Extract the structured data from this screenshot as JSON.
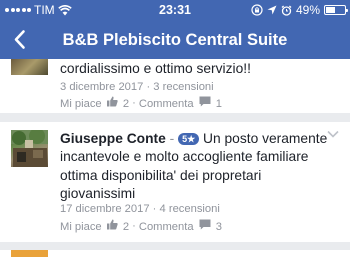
{
  "status_bar": {
    "carrier": "TIM",
    "time": "23:31",
    "battery_percent": "49%",
    "battery_level": 0.49
  },
  "header": {
    "title": "B&B Plebiscito Central Suite"
  },
  "reviews": [
    {
      "text": "cordialissimo e ottimo servizio!!",
      "date": "3 dicembre 2017",
      "recensioni": "3 recensioni",
      "like_label": "Mi piace",
      "like_count": "2",
      "comment_label": "Commenta",
      "comment_count": "1"
    },
    {
      "author": "Giuseppe Conte",
      "rating": "5★",
      "text_line1": "Un posto veramente",
      "text_line2": "incantevole e molto accogliente familiare",
      "text_line3": "ottima disponibilita' dei propretari",
      "text_line4": "giovanissimi",
      "date": "17 dicembre 2017",
      "recensioni": "4 recensioni",
      "like_label": "Mi piace",
      "like_count": "2",
      "comment_label": "Commenta",
      "comment_count": "3"
    }
  ],
  "separator": "·",
  "dash": "-",
  "colors": {
    "brand": "#4267b2",
    "background": "#e9ebee",
    "meta_text": "#90949c",
    "body_text": "#1d2129",
    "card3_accent": "#e9a23a"
  }
}
